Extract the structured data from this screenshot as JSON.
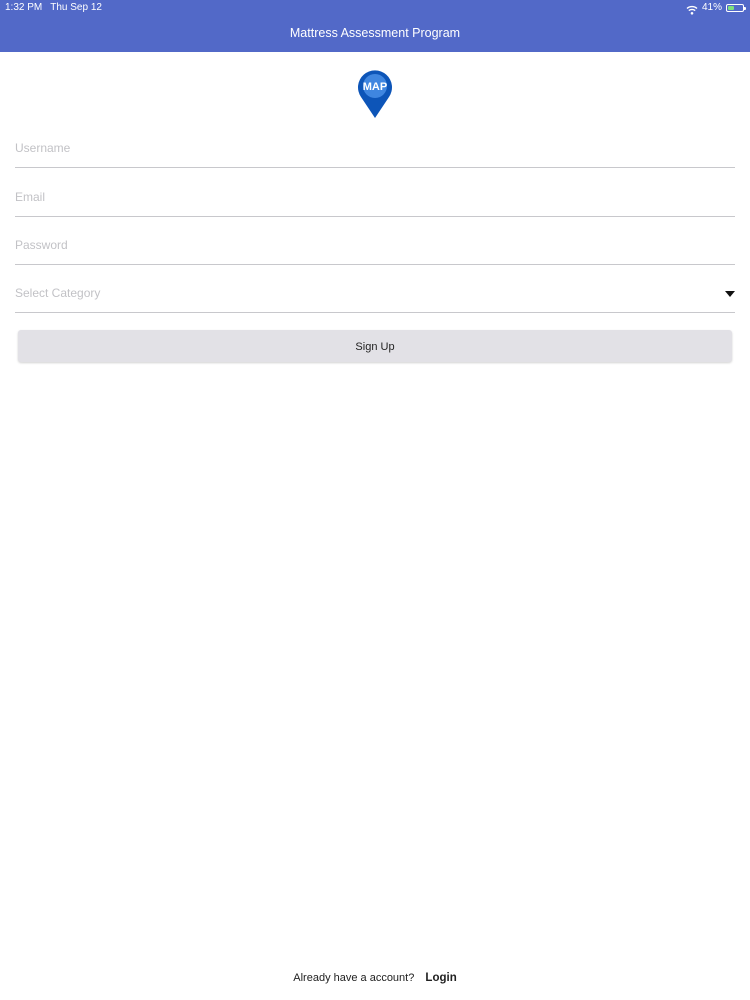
{
  "status_bar": {
    "time": "1:32 PM",
    "date": "Thu Sep 12",
    "battery_text": "41%",
    "battery_level": 0.41,
    "wifi_icon": "wifi-icon",
    "battery_icon": "battery-icon"
  },
  "header": {
    "title": "Mattress Assessment Program"
  },
  "logo": {
    "text": "MAP",
    "icon": "map-pin-icon",
    "color": "#0d55b8"
  },
  "form": {
    "username_placeholder": "Username",
    "email_placeholder": "Email",
    "password_placeholder": "Password",
    "category_placeholder": "Select Category",
    "submit_label": "Sign Up"
  },
  "footer": {
    "prompt": "Already have a account?",
    "login_label": "Login"
  },
  "colors": {
    "header_bg": "#5269c8",
    "button_bg": "#e2e1e6",
    "divider": "#c8c8cc"
  }
}
